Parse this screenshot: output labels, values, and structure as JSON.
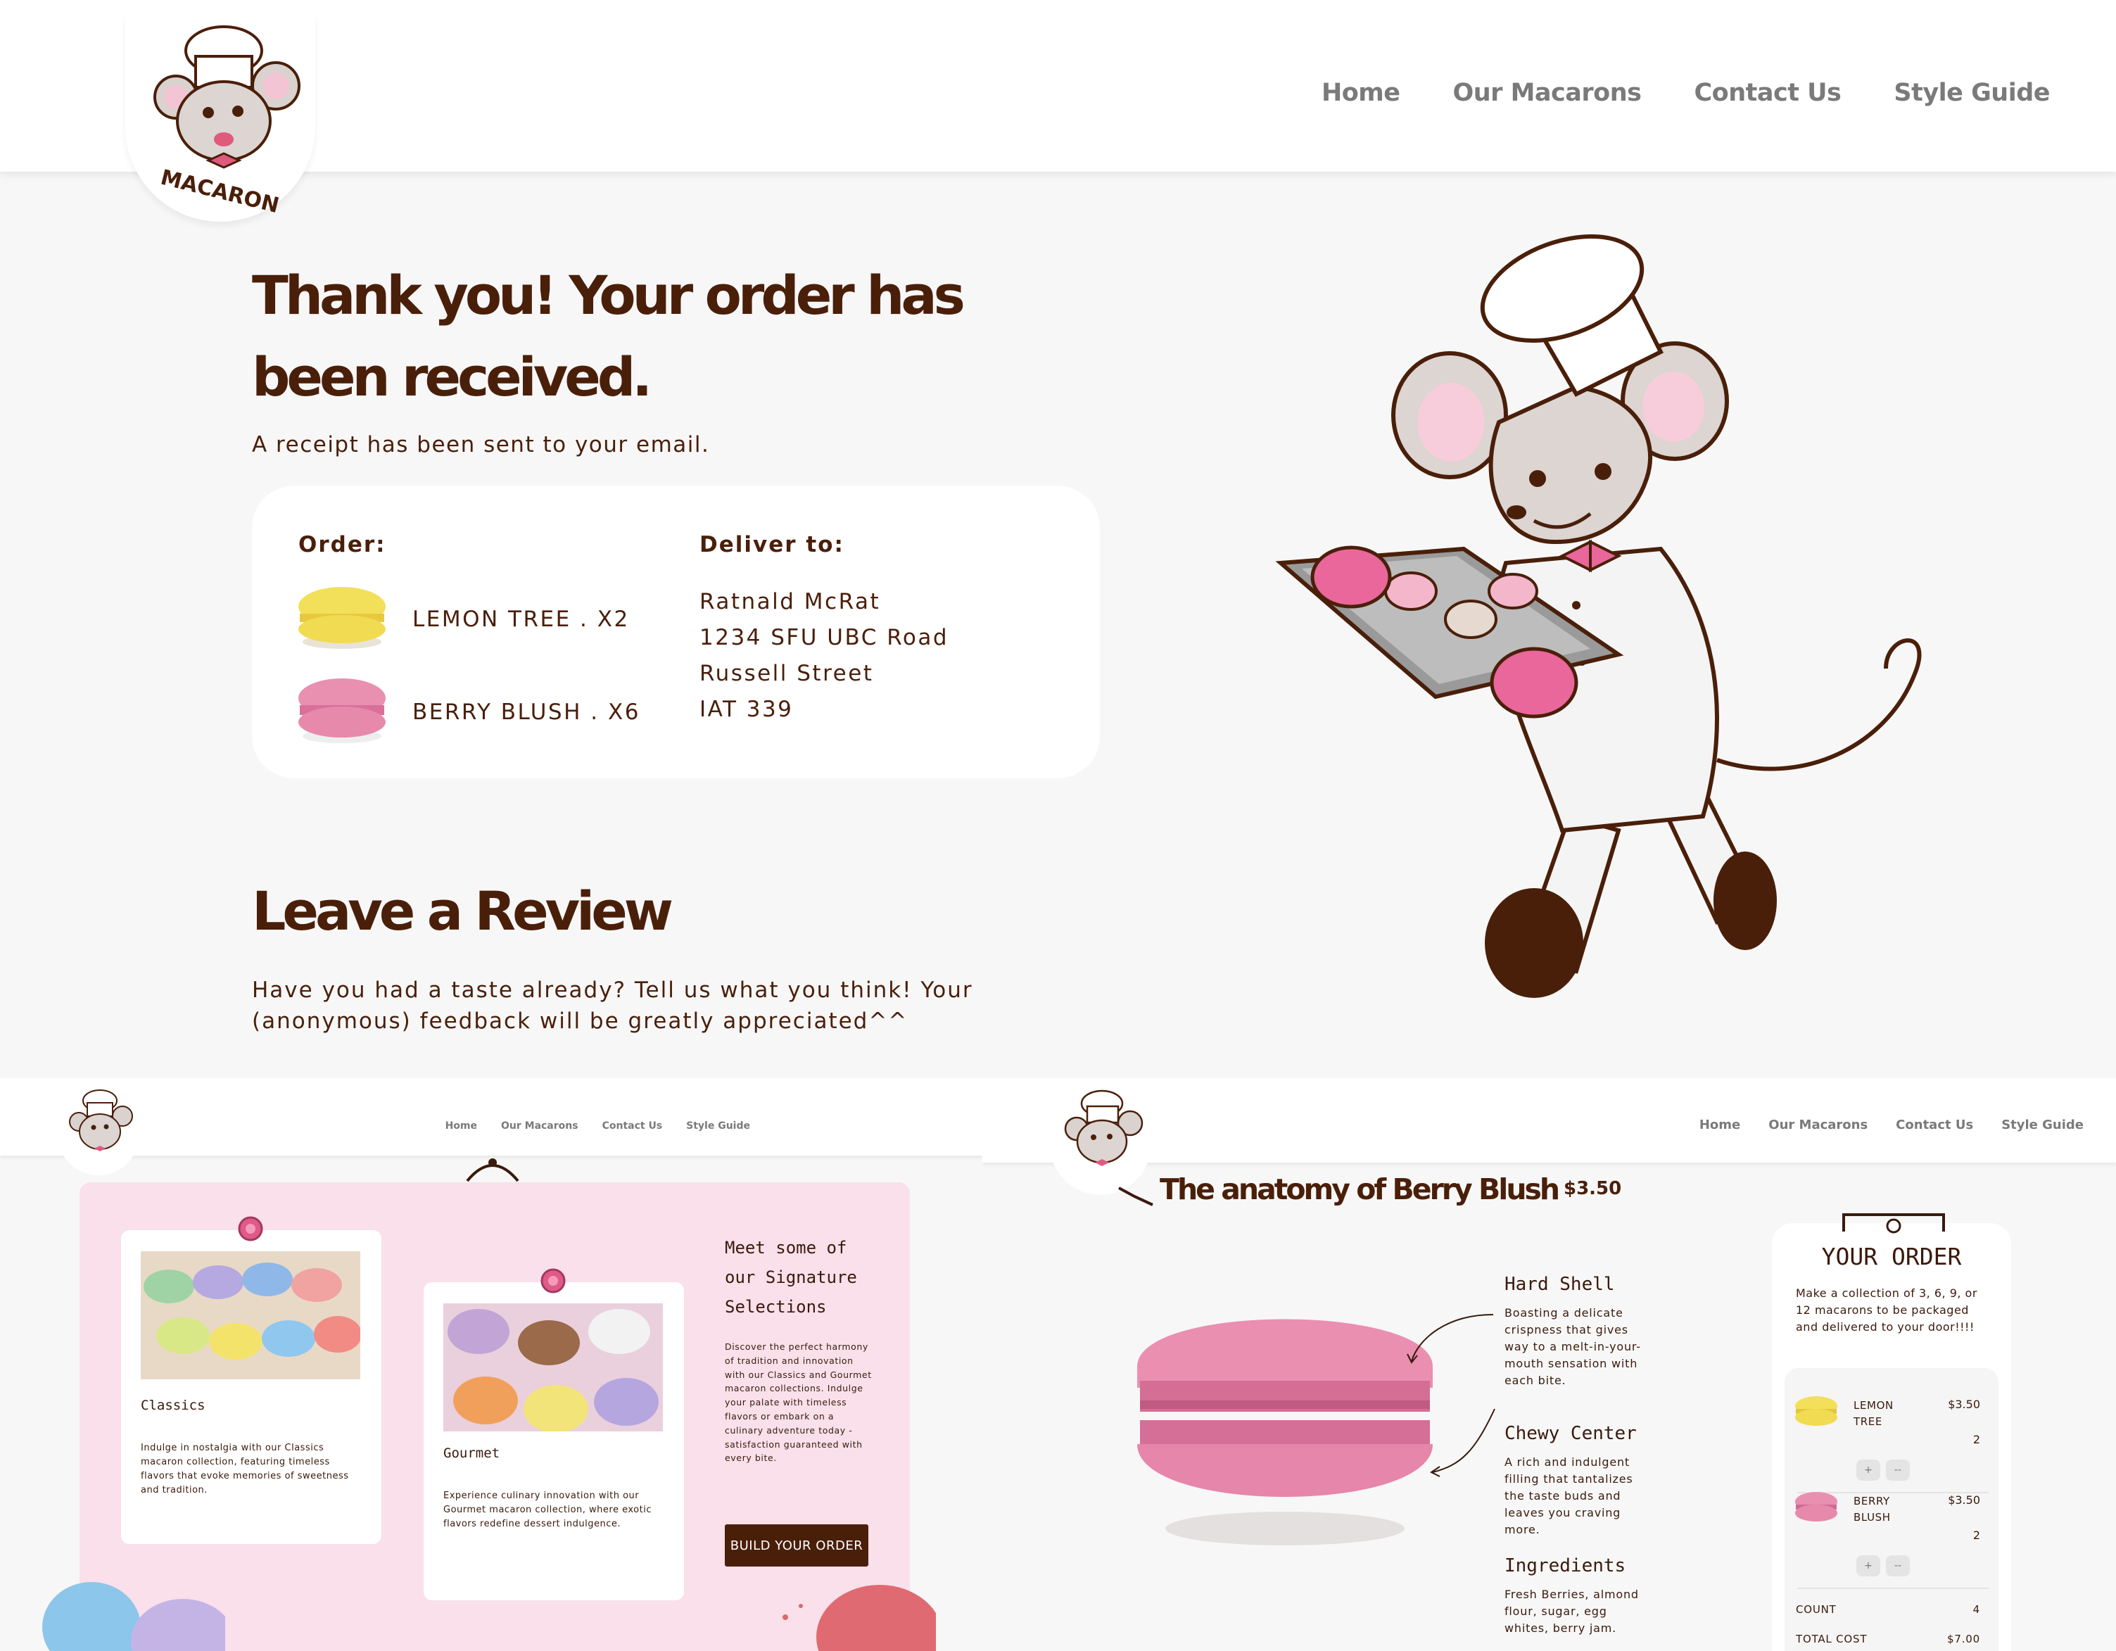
{
  "top": {
    "logo_text": "MACARON",
    "nav": [
      "Home",
      "Our Macarons",
      "Contact Us",
      "Style Guide"
    ],
    "headline": "Thank you! Your order has been received.",
    "subtext": "A receipt has been sent to your email.",
    "order": {
      "label": "Order:",
      "items": [
        {
          "name": "LEMON TREE . X2",
          "color": "#f3e05a"
        },
        {
          "name": "BERRY BLUSH . X6",
          "color": "#e98fb0"
        }
      ]
    },
    "deliver": {
      "label": "Deliver to:",
      "lines": [
        "Ratnald McRat",
        "1234 SFU UBC Road",
        "Russell Street",
        "IAT 339"
      ]
    },
    "review_title": "Leave a Review",
    "review_text": "Have you had a taste already? Tell us what you think! Your (anonymous) feedback will be greatly appreciated^^"
  },
  "bottom_left": {
    "nav": [
      "Home",
      "Our Macarons",
      "Contact Us",
      "Style Guide"
    ],
    "cards": [
      {
        "title": "Classics",
        "text": "Indulge in nostalgia with our Classics macaron collection, featuring timeless flavors that evoke memories of sweetness and tradition."
      },
      {
        "title": "Gourmet",
        "text": "Experience culinary innovation with our Gourmet macaron collection, where exotic flavors redefine dessert indulgence."
      }
    ],
    "signature_title": "Meet some of our Signature Selections",
    "signature_text": "Discover the perfect harmony of tradition and innovation with our Classics and Gourmet macaron collections. Indulge your palate with timeless flavors or embark on a culinary adventure today - satisfaction guaranteed with every bite.",
    "button": "BUILD YOUR ORDER"
  },
  "bottom_right": {
    "nav": [
      "Home",
      "Our Macarons",
      "Contact Us",
      "Style Guide"
    ],
    "title": "The anatomy of Berry Blush",
    "price": "$3.50",
    "annotations": [
      {
        "heading": "Hard Shell",
        "text": "Boasting a delicate crispness that gives way to a melt-in-your-mouth sensation with each bite."
      },
      {
        "heading": "Chewy Center",
        "text": "A rich and indulgent filling that tantalizes the taste buds and leaves you craving more."
      },
      {
        "heading": "Ingredients",
        "text": "Fresh Berries, almond flour, sugar, egg whites, berry jam."
      }
    ],
    "order": {
      "title": "YOUR ORDER",
      "desc": "Make a collection of 3, 6, 9, or 12 macarons to be packaged and delivered to your door!!!!",
      "items": [
        {
          "name": "LEMON TREE",
          "price": "$3.50",
          "qty": "2",
          "plus": "+",
          "minus": "--"
        },
        {
          "name": "BERRY BLUSH",
          "price": "$3.50",
          "qty": "2",
          "plus": "+",
          "minus": "--"
        }
      ],
      "count_label": "COUNT",
      "count": "4",
      "total_label": "TOTAL COST",
      "total": "$7.00"
    }
  },
  "colors": {
    "brown": "#4a1f0a",
    "pink": "#f9e0ea",
    "macaron_pink": "#e98fb0",
    "lemon": "#f3e05a"
  }
}
